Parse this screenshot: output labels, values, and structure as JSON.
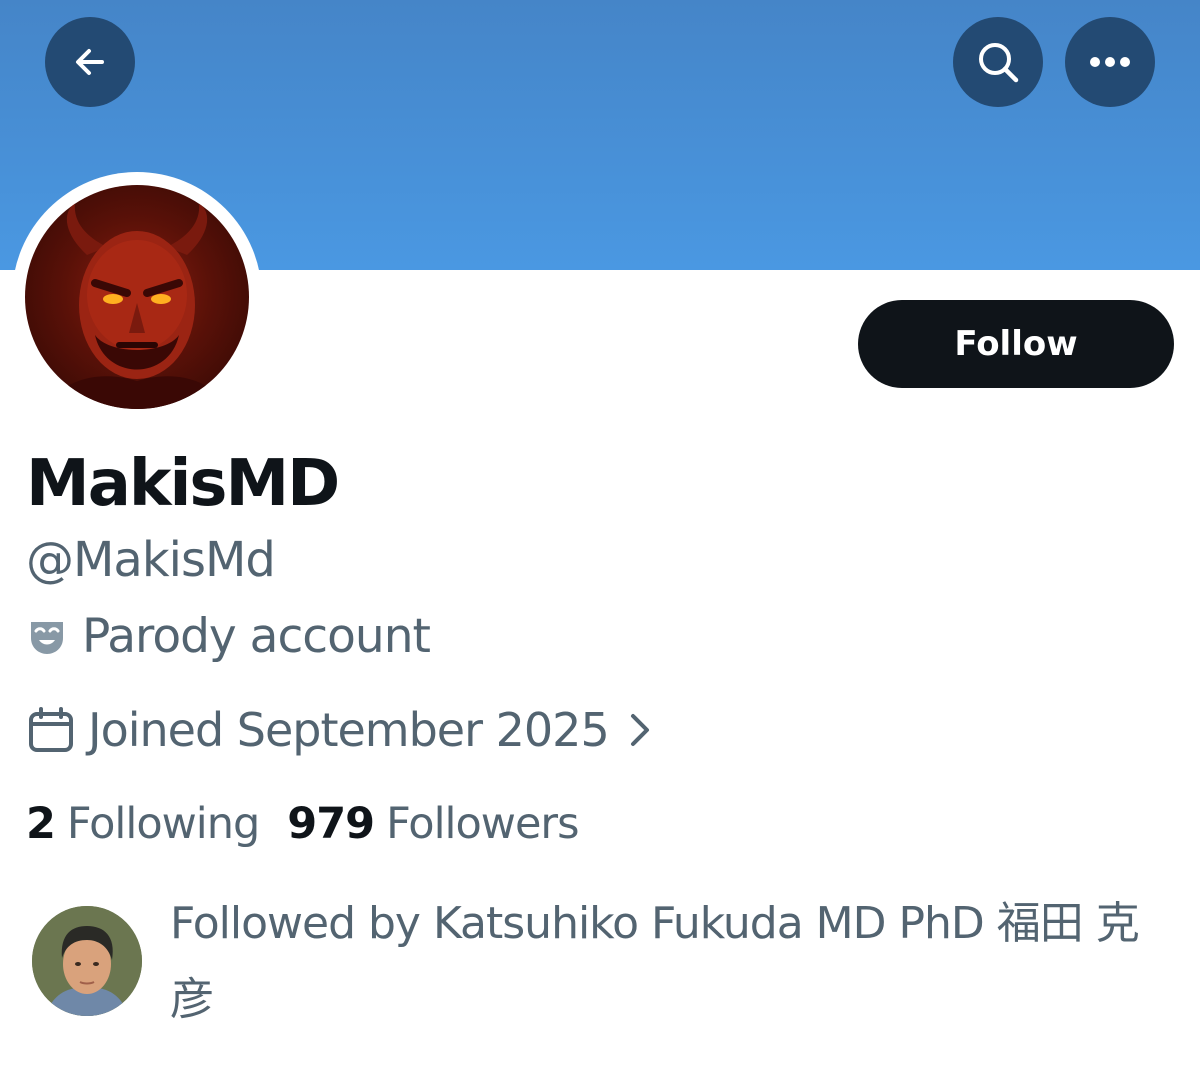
{
  "header": {
    "back_icon": "arrow-left-icon",
    "search_icon": "search-icon",
    "more_icon": "more-horizontal-icon",
    "banner_color": "#4a90d9"
  },
  "profile": {
    "display_name": "MakisMD",
    "handle": "@MakisMd",
    "parody_label": "Parody account",
    "parody_icon": "theater-mask-icon",
    "joined": "Joined September 2025",
    "joined_icon": "calendar-icon",
    "follow_label": "Follow"
  },
  "stats": {
    "following_count": "2",
    "following_label": "Following",
    "followers_count": "979",
    "followers_label": "Followers"
  },
  "followed_by": {
    "text": "Followed by Katsuhiko Fukuda MD PhD 福田 克彦"
  },
  "colors": {
    "primary_text": "#0f1419",
    "secondary_text": "#536471",
    "button_bg": "#0f1419",
    "icon_button_bg": "#234a73"
  }
}
